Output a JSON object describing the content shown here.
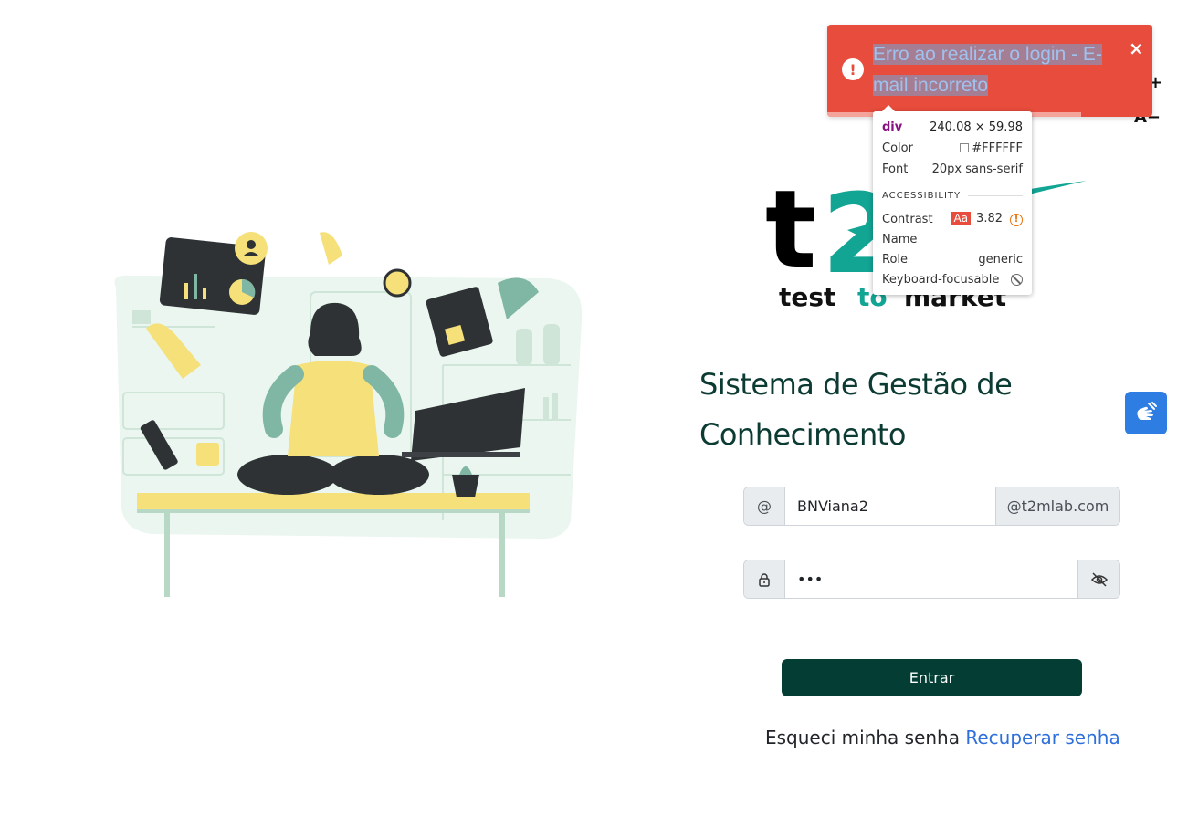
{
  "toast": {
    "message": "Erro ao realizar o login - E-mail incorreto",
    "close_label": "×",
    "icon": "exclamation-icon",
    "progress": 0.78,
    "color": "#e74c3c"
  },
  "inspector": {
    "tag": "div",
    "size": "240.08 × 59.98",
    "color_label": "Color",
    "color_value": "#FFFFFF",
    "font_label": "Font",
    "font_value": "20px sans-serif",
    "section_title": "ACCESSIBILITY",
    "contrast_label": "Contrast",
    "contrast_badge": "Aa",
    "contrast_value": "3.82",
    "name_label": "Name",
    "name_value": "",
    "role_label": "Role",
    "role_value": "generic",
    "focus_label": "Keyboard-focusable"
  },
  "font_controls": {
    "contrast_icon": "contrast-icon",
    "increase_label": "+",
    "decrease_label": "A−"
  },
  "logo": {
    "mark": "t2",
    "text_test": "test",
    "text_to": "to",
    "text_market": "market"
  },
  "heading": "Sistema de Gestão de Conhecimento",
  "form": {
    "email_prefix": "@",
    "email_value": "BNViana2",
    "email_domain": "@t2mlab.com",
    "password_value": "•••",
    "password_icon": "lock-icon",
    "eye_icon": "eye-slash-icon",
    "submit_label": "Entrar"
  },
  "recover": {
    "text": "Esqueci minha senha",
    "link": "Recuperar senha"
  },
  "accessibility_widget": {
    "icon": "sign-language-icon"
  },
  "colors": {
    "brand_dark": "#033d33",
    "brand_teal": "#12a594",
    "link": "#2f6fdc",
    "widget_blue": "#2d7de3"
  }
}
